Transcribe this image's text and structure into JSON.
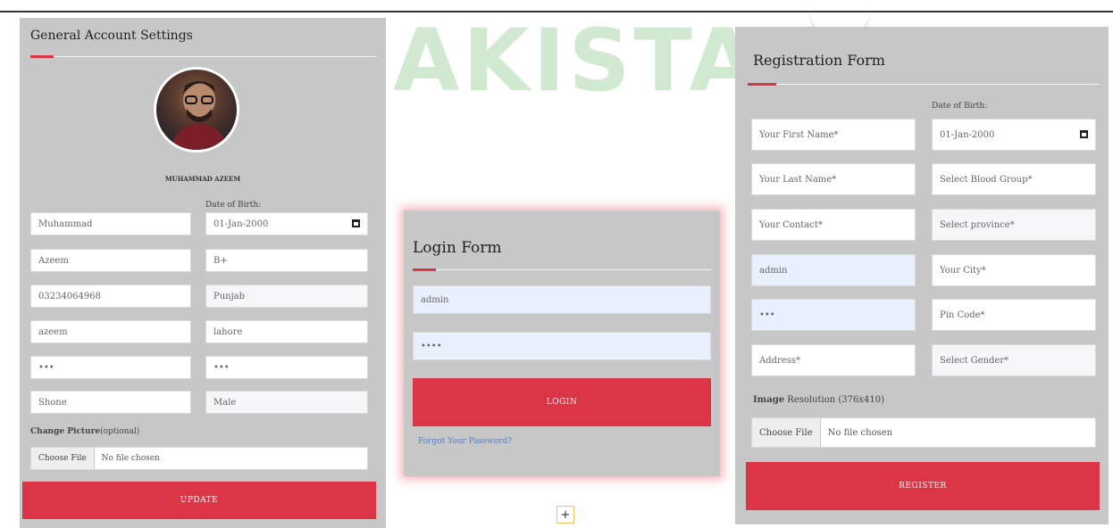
{
  "watermark": {
    "text": "AKISTA"
  },
  "account": {
    "title": "General Account Settings",
    "user_name": "MUHAMMAD AZEEM",
    "dob_label": "Date of Birth:",
    "fields": {
      "first_name": "Muhammad",
      "dob": "01-Jan-2000",
      "last_name": "Azeem",
      "blood_group": "B+",
      "contact": "03234064968",
      "province": "Punjab",
      "username": "azeem",
      "city": "lahore",
      "password": "•••",
      "pin": "•••",
      "address": "Shone",
      "gender": "Male"
    },
    "change_picture_label": "Change Picture",
    "change_picture_optional": "(optional)",
    "choose_file": "Choose File",
    "no_file": "No file chosen",
    "update_button": "UPDATE"
  },
  "login": {
    "title": "Login Form",
    "username": "admin",
    "password": "••••",
    "login_button": "LOGIN",
    "forgot_link": "Forgot Your Password?"
  },
  "registration": {
    "title": "Registration Form",
    "dob_label": "Date of Birth:",
    "placeholders": {
      "first_name": "Your First Name*",
      "last_name": "Your Last Name*",
      "blood_group": "Select Blood Group*",
      "contact": "Your Contact*",
      "province": "Select province*",
      "city": "Your City*",
      "pin": "Pin Code*",
      "address": "Address*",
      "gender": "Select Gender*"
    },
    "values": {
      "dob": "01-Jan-2000",
      "username": "admin",
      "password": "•••"
    },
    "image_label": "Image",
    "image_resolution": "Resolution (376x410)",
    "choose_file": "Choose File",
    "no_file": "No file chosen",
    "register_button": "REGISTER"
  },
  "fab": {
    "label": "+"
  }
}
